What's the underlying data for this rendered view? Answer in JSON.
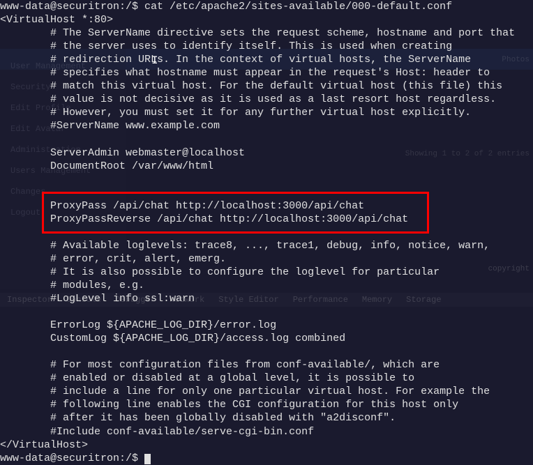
{
  "terminal": {
    "prompt_line": "www-data@securitron:/$ cat /etc/apache2/sites-available/000-default.conf",
    "lines": [
      "<VirtualHost *:80>",
      "        # The ServerName directive sets the request scheme, hostname and port that",
      "        # the server uses to identify itself. This is used when creating",
      "        # redirection URLs. In the context of virtual hosts, the ServerName",
      "        # specifies what hostname must appear in the request's Host: header to",
      "        # match this virtual host. For the default virtual host (this file) this",
      "        # value is not decisive as it is used as a last resort host regardless.",
      "        # However, you must set it for any further virtual host explicitly.",
      "        #ServerName www.example.com",
      "",
      "        ServerAdmin webmaster@localhost",
      "        DocumentRoot /var/www/html",
      "",
      "",
      "        ProxyPass /api/chat http://localhost:3000/api/chat",
      "        ProxyPassReverse /api/chat http://localhost:3000/api/chat",
      "",
      "        # Available loglevels: trace8, ..., trace1, debug, info, notice, warn,",
      "        # error, crit, alert, emerg.",
      "        # It is also possible to configure the loglevel for particular",
      "        # modules, e.g.",
      "        #LogLevel info ssl:warn",
      "",
      "        ErrorLog ${APACHE_LOG_DIR}/error.log",
      "        CustomLog ${APACHE_LOG_DIR}/access.log combined",
      "",
      "        # For most configuration files from conf-available/, which are",
      "        # enabled or disabled at a global level, it is possible to",
      "        # include a line for only one particular virtual host. For example the",
      "        # following line enables the CGI configuration for this host only",
      "        # after it has been globally disabled with \"a2disconf\".",
      "        #Include conf-available/serve-cgi-bin.conf",
      "</VirtualHost>"
    ],
    "end_prompt": "www-data@securitron:/$ "
  },
  "background": {
    "sidebar": [
      "User Management",
      "Security",
      "Edit Profile",
      "Edit Avatar",
      "Administration",
      "Users Management",
      "Changes",
      "Logout"
    ],
    "topbar_label": "Photos",
    "showing_text": "Showing 1 to 2 of 2 entries",
    "copyright": "copyright",
    "devtools": [
      "Inspector",
      "Console",
      "Debugger",
      "Network",
      "Style Editor",
      "Performance",
      "Memory",
      "Storage"
    ]
  }
}
